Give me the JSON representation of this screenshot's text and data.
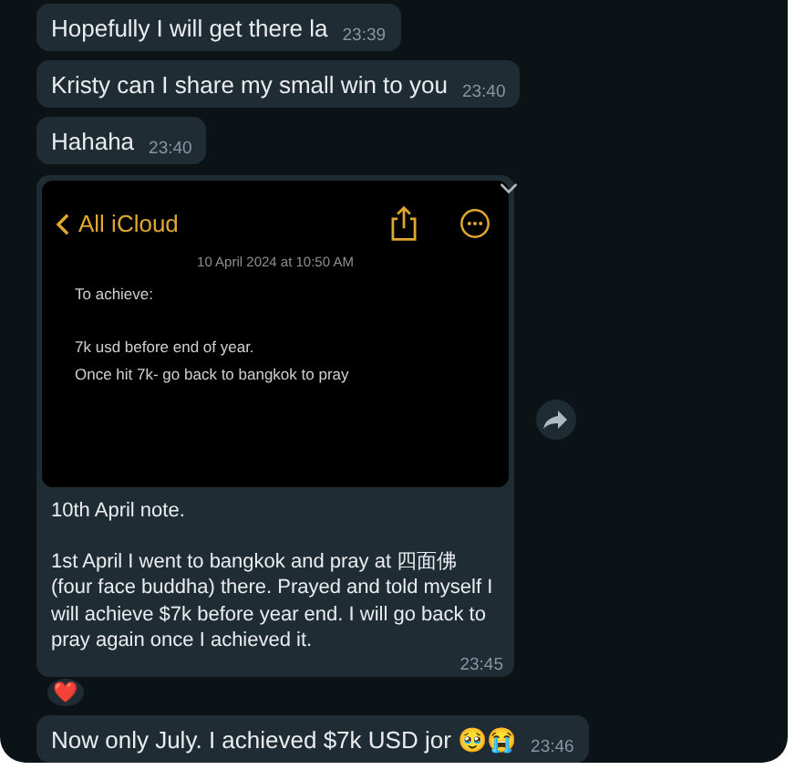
{
  "messages": [
    {
      "kind": "text",
      "text": "Hopefully I will get there la",
      "time": "23:39"
    },
    {
      "kind": "text",
      "text": "Kristy can I share my small win to you",
      "time": "23:40"
    },
    {
      "kind": "text",
      "text": "Hahaha",
      "time": "23:40"
    },
    {
      "kind": "image",
      "note": {
        "back": "All iCloud",
        "date": "10 April 2024 at 10:50 AM",
        "paragraphs": [
          [
            "To achieve:"
          ],
          [
            "7k usd before end of year.",
            "Once hit 7k- go back to bangkok to pray"
          ]
        ]
      },
      "caption": [
        "10th April note.",
        "1st April I went to bangkok and pray at 四面佛 (four face buddha) there. Prayed and told myself I will achieve $7k before year end. I will go back to pray again once I achieved it."
      ],
      "time": "23:45",
      "reaction": "❤️"
    },
    {
      "kind": "text",
      "text": "Now only July. I achieved $7k USD jor 🥹😭",
      "time": "23:46"
    }
  ]
}
